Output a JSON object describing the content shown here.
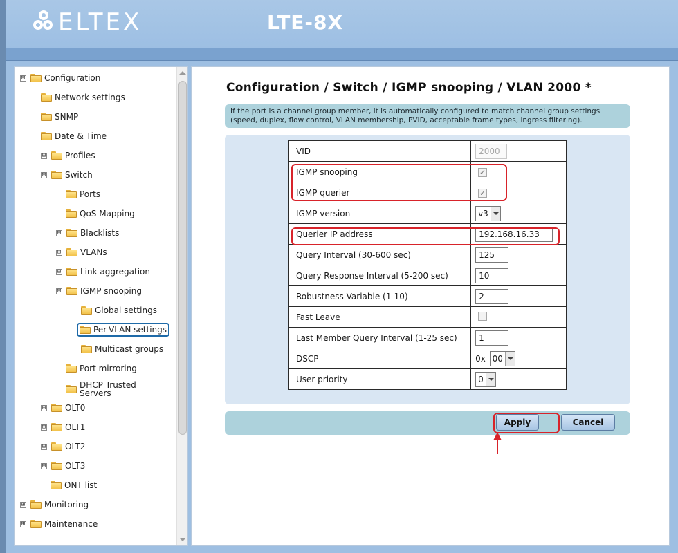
{
  "header": {
    "logo_text": "ELTEX",
    "product": "LTE-8X"
  },
  "sidebar": {
    "items": [
      {
        "label": "Configuration",
        "expander": "⊟"
      },
      {
        "label": "Network settings"
      },
      {
        "label": "SNMP"
      },
      {
        "label": "Date & Time"
      },
      {
        "label": "Profiles",
        "expander": "⊞"
      },
      {
        "label": "Switch",
        "expander": "⊟"
      },
      {
        "label": "Ports"
      },
      {
        "label": "QoS Mapping"
      },
      {
        "label": "Blacklists",
        "expander": "⊞"
      },
      {
        "label": "VLANs",
        "expander": "⊞"
      },
      {
        "label": "Link aggregation",
        "expander": "⊞"
      },
      {
        "label": "IGMP snooping",
        "expander": "⊟"
      },
      {
        "label": "Global settings"
      },
      {
        "label": "Per-VLAN settings",
        "selected": true
      },
      {
        "label": "Multicast groups"
      },
      {
        "label": "Port mirroring"
      },
      {
        "label": "DHCP Trusted Servers"
      },
      {
        "label": "OLT0",
        "expander": "⊞"
      },
      {
        "label": "OLT1",
        "expander": "⊞"
      },
      {
        "label": "OLT2",
        "expander": "⊞"
      },
      {
        "label": "OLT3",
        "expander": "⊞"
      },
      {
        "label": "ONT list"
      },
      {
        "label": "Monitoring",
        "expander": "⊞"
      },
      {
        "label": "Maintenance",
        "expander": "⊞"
      }
    ]
  },
  "main": {
    "title": "Configuration / Switch / IGMP snooping / VLAN 2000 *",
    "info_line1": "If the port is a channel group member, it is automatically configured to match channel group settings",
    "info_line2": "(speed, duplex, flow control, VLAN membership, PVID, acceptable frame types, ingress filtering).",
    "rows": {
      "vid": {
        "label": "VID",
        "value": "2000"
      },
      "igmp_snooping": {
        "label": "IGMP snooping",
        "checked": true
      },
      "igmp_querier": {
        "label": "IGMP querier",
        "checked": true
      },
      "igmp_version": {
        "label": "IGMP version",
        "value": "v3"
      },
      "querier_ip": {
        "label": "Querier IP address",
        "value": "192.168.16.33"
      },
      "query_interval": {
        "label": "Query Interval (30-600 sec)",
        "value": "125"
      },
      "query_response": {
        "label": "Query Response Interval (5-200 sec)",
        "value": "10"
      },
      "robustness": {
        "label": "Robustness Variable (1-10)",
        "value": "2"
      },
      "fast_leave": {
        "label": "Fast Leave",
        "checked": false
      },
      "last_member": {
        "label": "Last Member Query Interval (1-25 sec)",
        "value": "1"
      },
      "dscp": {
        "label": "DSCP",
        "prefix": "0x",
        "value": "00"
      },
      "user_priority": {
        "label": "User priority",
        "value": "0"
      }
    },
    "check_mark": "✓",
    "apply_label": "Apply",
    "cancel_label": "Cancel"
  },
  "colors": {
    "highlight": "#d8232a",
    "header_bg": "#a9c7e6",
    "info_bg": "#add2dc"
  }
}
